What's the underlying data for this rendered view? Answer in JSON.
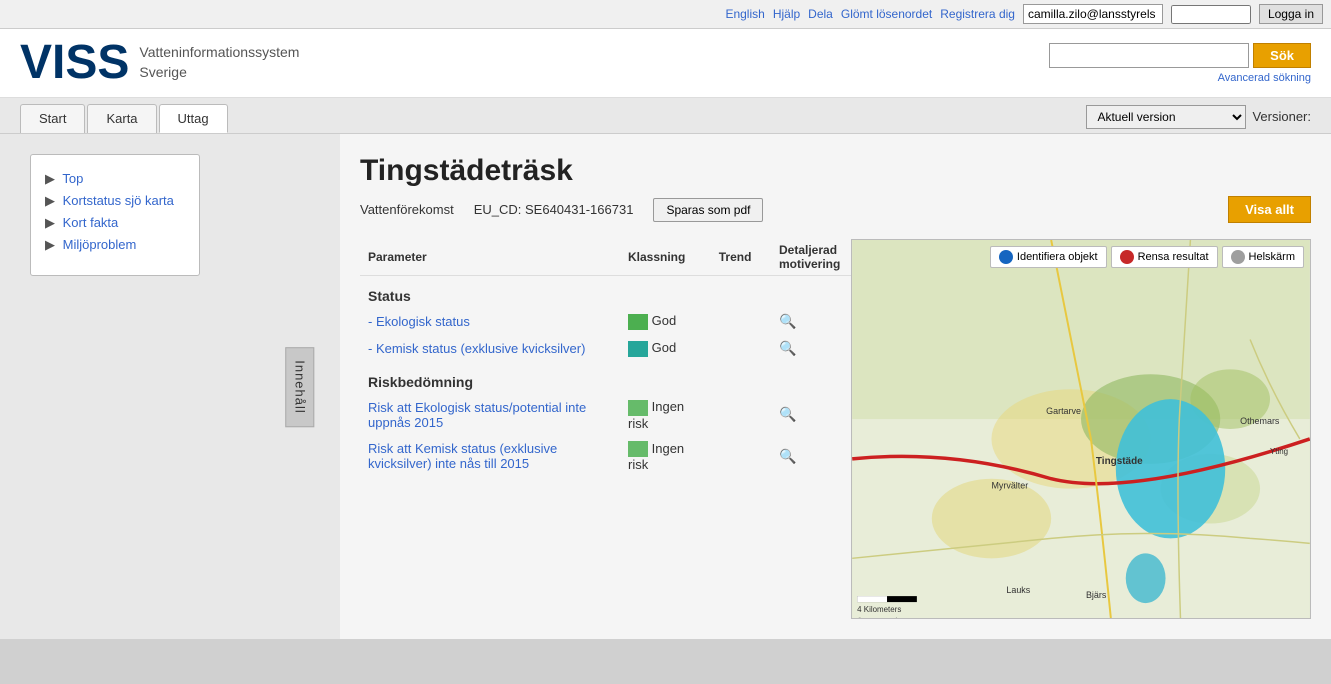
{
  "topbar": {
    "english": "English",
    "hjalp": "Hjälp",
    "dela": "Dela",
    "forgot": "Glömt lösenordet",
    "register": "Registrera dig",
    "username": "camilla.zilo@lansstyrels",
    "password_placeholder": "",
    "login_btn": "Logga in"
  },
  "header": {
    "logo": "VISS",
    "subtitle_line1": "Vatteninformationssystem",
    "subtitle_line2": "Sverige",
    "search_placeholder": "",
    "search_btn": "Sök",
    "advanced_search": "Avancerad sökning"
  },
  "nav": {
    "tabs": [
      {
        "id": "start",
        "label": "Start"
      },
      {
        "id": "karta",
        "label": "Karta"
      },
      {
        "id": "uttag",
        "label": "Uttag"
      }
    ],
    "version_label": "Aktuell version",
    "versioner": "Versioner:"
  },
  "sidebar": {
    "inhall": "Innehåll",
    "items": [
      {
        "label": "Top",
        "href": "#"
      },
      {
        "label": "Kortstatus sjö karta",
        "href": "#"
      },
      {
        "label": "Kort fakta",
        "href": "#"
      },
      {
        "label": "Miljöproblem",
        "href": "#"
      }
    ]
  },
  "page": {
    "title": "Tingstädeträsk",
    "vattenforekomst": "Vattenförekomst",
    "eu_cd": "EU_CD: SE640431-166731",
    "pdf_btn": "Sparas som pdf",
    "visa_allt": "Visa allt"
  },
  "table": {
    "col_parameter": "Parameter",
    "col_klassning": "Klassning",
    "col_trend": "Trend",
    "col_detaljerad": "Detaljerad",
    "col_motivering": "motivering",
    "section_status": "Status",
    "section_risk": "Riskbedömning",
    "rows_status": [
      {
        "param": "- Ekologisk status",
        "klassning_label": "God",
        "color": "green"
      },
      {
        "param": "- Kemisk status (exklusive kvicksilver)",
        "klassning_label": "God",
        "color": "teal"
      }
    ],
    "rows_risk": [
      {
        "param": "Risk att Ekologisk status/potential inte uppnås 2015",
        "klassning_label": "Ingen risk",
        "color": "green2"
      },
      {
        "param": "Risk att Kemisk status (exklusive kvicksilver) inte nås till 2015",
        "klassning_label": "Ingen risk",
        "color": "green2"
      }
    ]
  },
  "map": {
    "identify_btn": "Identifiera objekt",
    "clear_btn": "Rensa resultat",
    "fullscreen_btn": "Helskärm",
    "scale_label": "4 Kilometers",
    "attribution": "© Lantmäteriet, SMHI, NVDB, ESRI Inc."
  }
}
